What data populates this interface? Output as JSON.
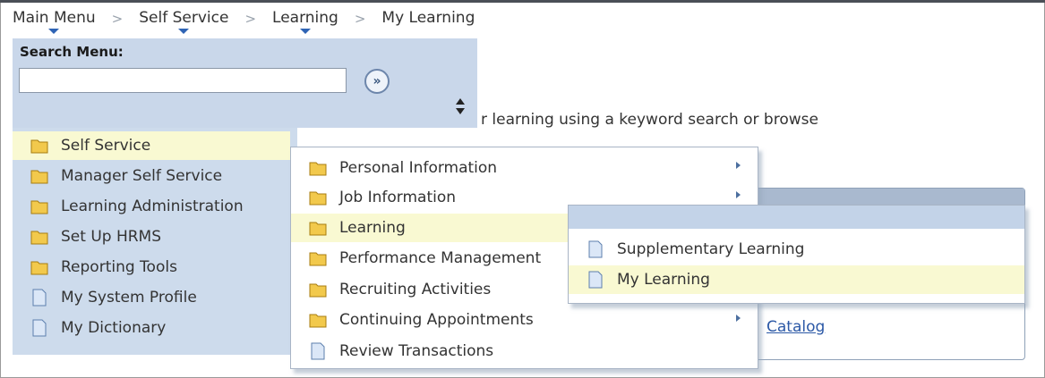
{
  "breadcrumb": [
    "Main Menu",
    "Self Service",
    "Learning",
    "My Learning"
  ],
  "breadcrumb_separator": ">",
  "search": {
    "label": "Search Menu:",
    "value": "",
    "placeholder": "",
    "go_symbol": "»"
  },
  "page_text": "r learning using a keyword search or browse",
  "page_link": "Catalog",
  "menu_level1": [
    {
      "label": "Self Service",
      "icon": "folder-icon",
      "highlighted": true
    },
    {
      "label": "Manager Self Service",
      "icon": "folder-icon"
    },
    {
      "label": "Learning Administration",
      "icon": "folder-icon"
    },
    {
      "label": "Set Up HRMS",
      "icon": "folder-icon"
    },
    {
      "label": "Reporting Tools",
      "icon": "folder-icon"
    },
    {
      "label": "My System Profile",
      "icon": "page-icon"
    },
    {
      "label": "My Dictionary",
      "icon": "page-icon"
    }
  ],
  "menu_level2": [
    {
      "label": "Personal Information",
      "icon": "folder-icon",
      "has_submenu": true
    },
    {
      "label": "Job Information",
      "icon": "folder-icon",
      "has_submenu": true
    },
    {
      "label": "Learning",
      "icon": "folder-icon",
      "highlighted": true
    },
    {
      "label": "Performance Management",
      "icon": "folder-icon"
    },
    {
      "label": "Recruiting Activities",
      "icon": "folder-icon"
    },
    {
      "label": "Continuing Appointments",
      "icon": "folder-icon",
      "has_submenu": true
    },
    {
      "label": "Review Transactions",
      "icon": "page-icon"
    }
  ],
  "menu_level3": [
    {
      "label": "Supplementary Learning",
      "icon": "page-icon"
    },
    {
      "label": "My Learning",
      "icon": "page-icon",
      "highlighted": true
    }
  ],
  "colors": {
    "breadcrumb_caret": "#2f64b5",
    "panel_blue": "#cddbec",
    "highlight": "#f9f9d2",
    "folder_yellow": "#f2c94c",
    "link_blue": "#2b58a6"
  }
}
